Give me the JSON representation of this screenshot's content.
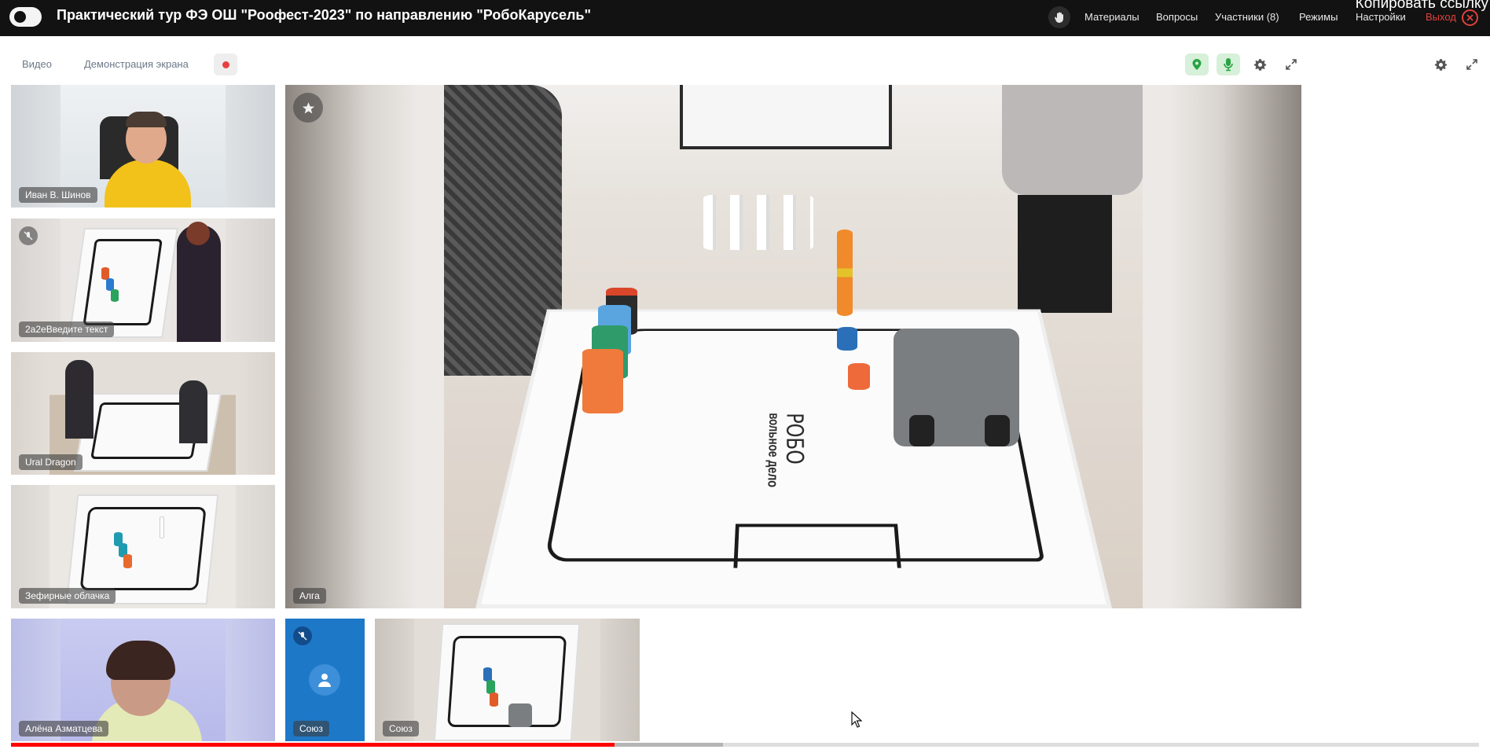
{
  "header": {
    "title": "Практический тур ФЭ ОШ \"Роофест-2023\" по направлению \"РобоКарусель\"",
    "menu": {
      "materials": "Материалы",
      "questions": "Вопросы",
      "participants": "Участники (8)",
      "modes": "Режимы",
      "settings": "Настройки",
      "exit": "Выход"
    },
    "copy_link": "Копировать ссылку"
  },
  "toolbar": {
    "tab_video": "Видео",
    "tab_screen_share": "Демонстрация экрана"
  },
  "tiles": {
    "ivan": "Иван В. Шинов",
    "team_2a2e": "2а2еВведите текст",
    "ural_dragon": "Ural Dragon",
    "zefirnye": "Зефирные облачка",
    "alga": "Алга",
    "alena": "Алёна Азматцева",
    "soyuz_avatar": "Союз",
    "soyuz_video": "Союз"
  },
  "mat_logo": {
    "line1": "РОБО",
    "line2": "вольное дело"
  },
  "player": {
    "progress": 0.411,
    "buffered": 0.485
  },
  "colors": {
    "topbar_bg": "#121212",
    "exit_red": "#e0413c",
    "mic_green": "#2aa345",
    "progress_red": "#ff0000",
    "avatar_blue": "#1e78c8"
  },
  "icons": {
    "toggle": "toggle-switch-icon",
    "hand": "raise-hand-icon",
    "exit": "exit-circle-x-icon",
    "record": "record-dot-icon",
    "location": "location-pin-icon",
    "mic": "microphone-icon",
    "settings": "gear-icon",
    "fullscreen": "expand-arrows-icon",
    "muted": "muted-mic-icon",
    "star": "star-icon",
    "avatar": "person-icon",
    "cursor": "mouse-pointer-icon"
  }
}
